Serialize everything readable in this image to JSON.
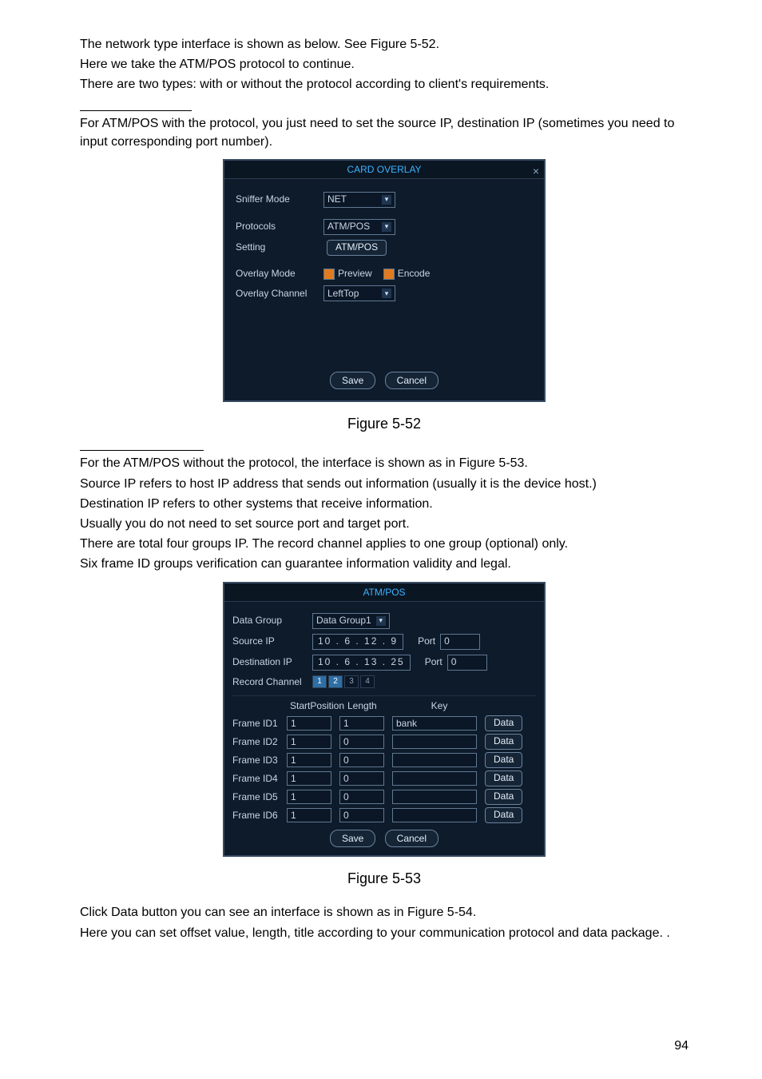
{
  "para": {
    "p1": "The network type interface is shown as below. See Figure 5-52.",
    "p2": "Here we take the ATM/POS protocol to continue.",
    "p3": "There are two types: with or without the protocol according to client's requirements.",
    "p4": "For ATM/POS with the protocol, you just need to set the source IP, destination IP (sometimes you need to input corresponding port number).",
    "fig1": "Figure 5-52",
    "p5": "For the ATM/POS without the protocol, the interface is shown as in Figure 5-53.",
    "p6": "Source IP refers to host IP address that sends out information (usually it is the device host.)",
    "p7": "Destination IP refers to other systems that receive information.",
    "p8": "Usually you do not need to set source port and target port.",
    "p9": "There are total four groups IP. The record channel applies to one group (optional) only.",
    "p10": "Six frame ID groups verification can guarantee information validity and legal.",
    "fig2": "Figure 5-53",
    "p11": "Click Data button you can see an interface is shown as in Figure 5-54.",
    "p12": "Here you can set offset value, length, title according to your communication protocol and data package. ."
  },
  "dlg1": {
    "title": "CARD OVERLAY",
    "labels": {
      "sniffer": "Sniffer Mode",
      "protocols": "Protocols",
      "setting": "Setting",
      "overlayMode": "Overlay Mode",
      "overlayChannel": "Overlay Channel"
    },
    "values": {
      "sniffer": "NET",
      "protocols": "ATM/POS",
      "setting": "ATM/POS",
      "preview": "Preview",
      "encode": "Encode",
      "overlayChannel": "LeftTop"
    },
    "buttons": {
      "save": "Save",
      "cancel": "Cancel"
    }
  },
  "dlg2": {
    "title": "ATM/POS",
    "labels": {
      "dataGroup": "Data Group",
      "sourceIp": "Source IP",
      "destIp": "Destination IP",
      "recordCh": "Record Channel",
      "port": "Port",
      "startPos": "StartPosition",
      "length": "Length",
      "key": "Key"
    },
    "values": {
      "dataGroup": "Data Group1",
      "sourceIp": "10 . 6 . 12 . 9",
      "sourcePort": "0",
      "destIp": "10 . 6 . 13 . 25",
      "destPort": "0"
    },
    "channels": [
      "1",
      "2",
      "3",
      "4"
    ],
    "channelSel": [
      true,
      true,
      false,
      false
    ],
    "rows": [
      {
        "label": "Frame ID1",
        "sp": "1",
        "len": "1",
        "key": "bank",
        "btn": "Data"
      },
      {
        "label": "Frame ID2",
        "sp": "1",
        "len": "0",
        "key": "",
        "btn": "Data"
      },
      {
        "label": "Frame ID3",
        "sp": "1",
        "len": "0",
        "key": "",
        "btn": "Data"
      },
      {
        "label": "Frame ID4",
        "sp": "1",
        "len": "0",
        "key": "",
        "btn": "Data"
      },
      {
        "label": "Frame ID5",
        "sp": "1",
        "len": "0",
        "key": "",
        "btn": "Data"
      },
      {
        "label": "Frame ID6",
        "sp": "1",
        "len": "0",
        "key": "",
        "btn": "Data"
      }
    ],
    "buttons": {
      "save": "Save",
      "cancel": "Cancel"
    }
  },
  "pageNumber": "94"
}
